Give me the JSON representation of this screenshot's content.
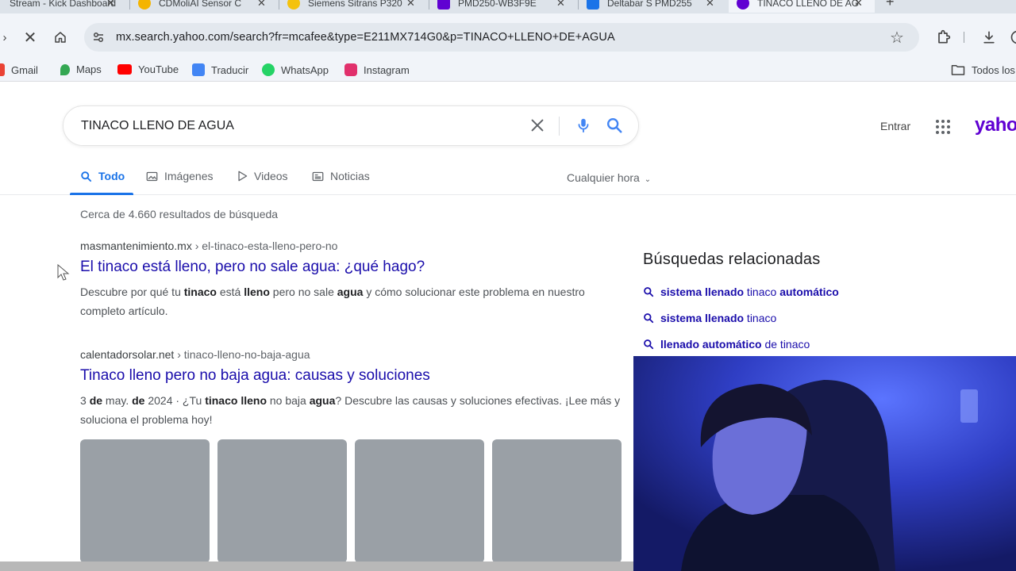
{
  "browser": {
    "tabs": [
      {
        "title": "Stream - Kick Dashboard",
        "favicon_color": "#53fc18"
      },
      {
        "title": "CDMoliAI Sensor C",
        "favicon_color": "#f4b400"
      },
      {
        "title": "Siemens Sitrans P320",
        "favicon_color": "#f4c20d"
      },
      {
        "title": "PMD250-WB3F9E",
        "favicon_color": "#6001d2"
      },
      {
        "title": "Deltabar S PMD255",
        "favicon_color": "#1a73e8"
      },
      {
        "title": "TINACO LLENO DE AGUA",
        "favicon_color": "#6001d2",
        "active": true
      }
    ],
    "url": "mx.search.yahoo.com/search?fr=mcafee&type=E211MX714G0&p=TINACO+LLENO+DE+AGUA",
    "bookmarks": [
      {
        "label": "Gmail",
        "color": "#ea4335"
      },
      {
        "label": "Maps",
        "color": "#34a853"
      },
      {
        "label": "YouTube",
        "color": "#ff0000"
      },
      {
        "label": "Traducir",
        "color": "#4285f4"
      },
      {
        "label": "WhatsApp",
        "color": "#25d366"
      },
      {
        "label": "Instagram",
        "color": "#e1306c"
      }
    ],
    "bookmarks_folder": "Todos los"
  },
  "search": {
    "query": "TINACO LLENO DE AGUA",
    "signin": "Entrar",
    "logo": "yahoo",
    "tabs": [
      "Todo",
      "Imágenes",
      "Videos",
      "Noticias"
    ],
    "time_filter": "Cualquier hora",
    "results_count": "Cerca de 4.660 resultados de búsqueda"
  },
  "results": [
    {
      "domain": "masmantenimiento.mx",
      "path": "› el-tinaco-esta-lleno-pero-no",
      "title": "El tinaco está lleno, pero no sale agua: ¿qué hago?",
      "snippet_parts": [
        {
          "t": "Descubre por qué tu ",
          "b": false
        },
        {
          "t": "tinaco",
          "b": true
        },
        {
          "t": " está ",
          "b": false
        },
        {
          "t": "lleno",
          "b": true
        },
        {
          "t": " pero no sale ",
          "b": false
        },
        {
          "t": "agua",
          "b": true
        },
        {
          "t": " y cómo solucionar este problema en nuestro completo artículo.",
          "b": false
        }
      ]
    },
    {
      "domain": "calentadorsolar.net",
      "path": "› tinaco-lleno-no-baja-agua",
      "title": "Tinaco lleno pero no baja agua: causas y soluciones",
      "snippet_parts": [
        {
          "t": "3 ",
          "b": false
        },
        {
          "t": "de",
          "b": true
        },
        {
          "t": " may. ",
          "b": false
        },
        {
          "t": "de",
          "b": true
        },
        {
          "t": " 2024 · ¿Tu ",
          "b": false
        },
        {
          "t": "tinaco lleno",
          "b": true
        },
        {
          "t": " no baja ",
          "b": false
        },
        {
          "t": "agua",
          "b": true
        },
        {
          "t": "? Descubre las causas y soluciones efectivas. ¡Lee más y soluciona el problema hoy!",
          "b": false
        }
      ]
    }
  ],
  "related": {
    "title": "Búsquedas relacionadas",
    "items": [
      {
        "parts": [
          {
            "t": "sistema llenado",
            "b": true
          },
          {
            "t": " tinaco ",
            "b": false
          },
          {
            "t": "automático",
            "b": true
          }
        ]
      },
      {
        "parts": [
          {
            "t": "sistema llenado",
            "b": true
          },
          {
            "t": " tinaco",
            "b": false
          }
        ]
      },
      {
        "parts": [
          {
            "t": "llenado automático",
            "b": true
          },
          {
            "t": " de tinaco",
            "b": false
          }
        ]
      }
    ]
  },
  "colors": {
    "link": "#1a0dab",
    "accent": "#1a73e8",
    "yahoo": "#6001d2"
  }
}
